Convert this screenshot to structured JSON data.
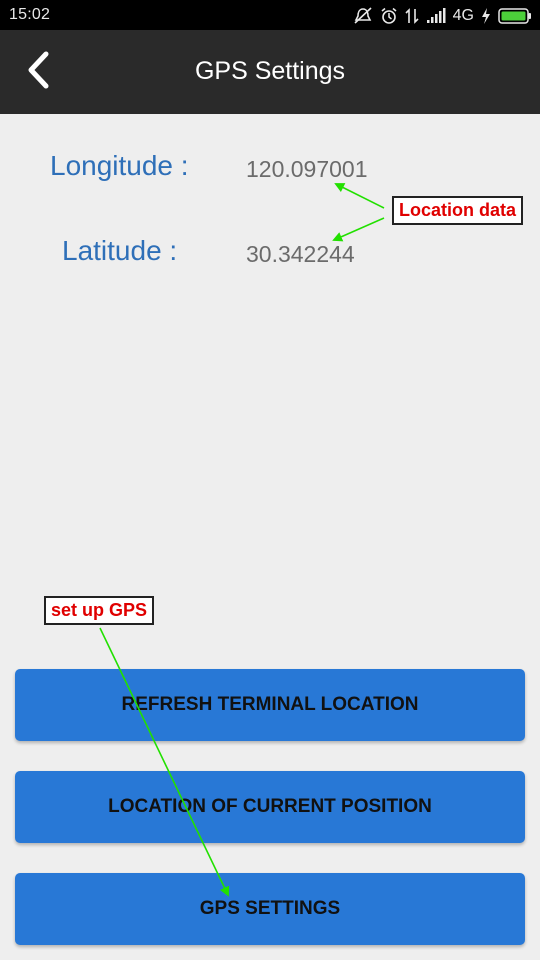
{
  "status_bar": {
    "time": "15:02",
    "network": "4G",
    "icons": [
      "mute-icon",
      "alarm-icon",
      "data-transfer-icon",
      "signal-icon",
      "charging-icon",
      "battery-icon"
    ]
  },
  "header": {
    "title": "GPS Settings",
    "back_icon": "chevron-left-icon"
  },
  "location": {
    "longitude_label": "Longitude :",
    "longitude_value": "120.097001",
    "latitude_label": "Latitude :",
    "latitude_value": "30.342244"
  },
  "annotations": {
    "location_data": "Location data",
    "set_up_gps": "set up GPS"
  },
  "buttons": {
    "refresh": "REFRESH TERMINAL LOCATION",
    "current_position": "LOCATION OF CURRENT POSITION",
    "gps_settings": "GPS SETTINGS"
  },
  "colors": {
    "status_bar_bg": "#000000",
    "app_bar_bg": "#2a2a2a",
    "page_bg": "#eeeeee",
    "label_blue": "#2e6fb8",
    "value_gray": "#6b6b6b",
    "button_blue": "#2878d6",
    "annotation_red": "#e00000",
    "annotation_arrow": "#22e000",
    "battery_green": "#4cd03a"
  }
}
